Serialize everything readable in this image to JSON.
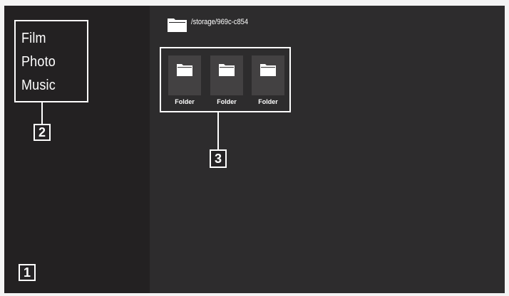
{
  "sidebar": {
    "menu": [
      {
        "label": "Film"
      },
      {
        "label": "Photo"
      },
      {
        "label": "Music"
      }
    ]
  },
  "callouts": {
    "c1": "1",
    "c2": "2",
    "c3": "3"
  },
  "path": {
    "text": "/storage/969c-c854",
    "icon": "folder-icon"
  },
  "items": [
    {
      "label": "Folder",
      "icon": "folder-icon"
    },
    {
      "label": "Folder",
      "icon": "folder-icon"
    },
    {
      "label": "Folder",
      "icon": "folder-icon"
    }
  ],
  "colors": {
    "background": "#2d2c2d",
    "sidebar": "#232122",
    "tile": "#434142",
    "accent": "#ffffff"
  }
}
